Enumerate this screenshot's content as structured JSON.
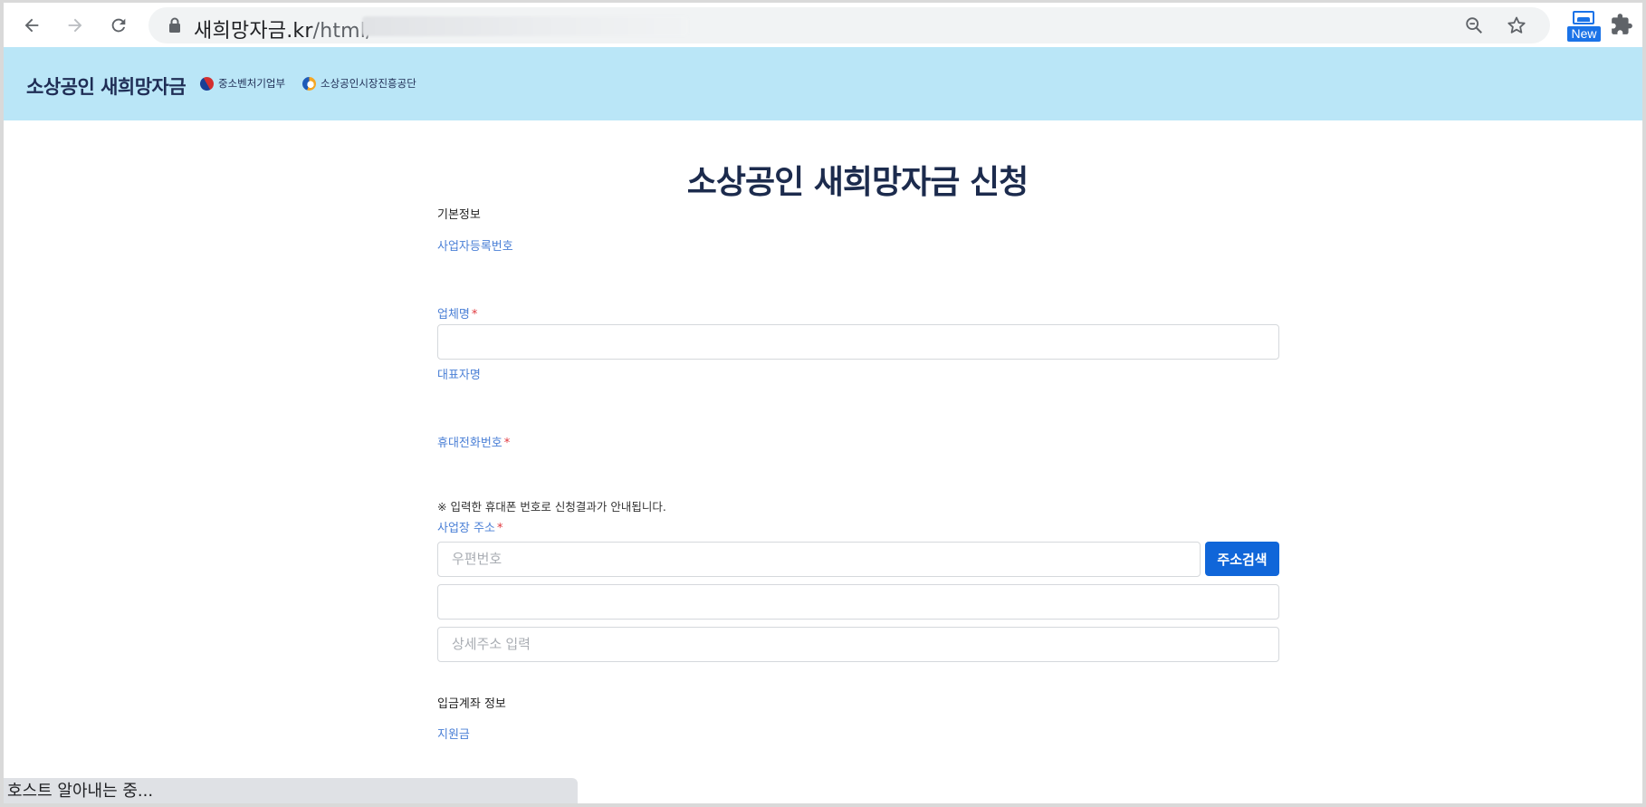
{
  "browser": {
    "url_host": "새희망자금.kr",
    "url_path": "/html/",
    "url_trailing": "_",
    "zoom_icon": "zoom-out-icon",
    "bookmark_icon": "star-icon",
    "extension_badge": "New",
    "status_text": "호스트 알아내는 중..."
  },
  "site": {
    "brand": "소상공인 새희망자금",
    "org1": "중소벤처기업부",
    "org2": "소상공인시장진흥공단",
    "header_color": "#bae6f7"
  },
  "form": {
    "title": "소상공인 새희망자금 신청",
    "basic_info_heading": "기본정보",
    "business_number_label": "사업자등록번호",
    "company_name_label": "업체명",
    "company_name_value": "",
    "representative_label": "대표자명",
    "mobile_label": "휴대전화번호",
    "mobile_note": "※ 입력한 휴대폰 번호로 신청결과가 안내됩니다.",
    "address_label": "사업장 주소",
    "postal_code_placeholder": "우편번호",
    "address_search_button": "주소검색",
    "address_value": "",
    "detail_address_placeholder": "상세주소 입력",
    "deposit_heading": "입금계좌 정보",
    "support_label": "지원금",
    "required_mark": "*",
    "accent_color": "#1066d9",
    "label_color": "#4a7fd6"
  }
}
